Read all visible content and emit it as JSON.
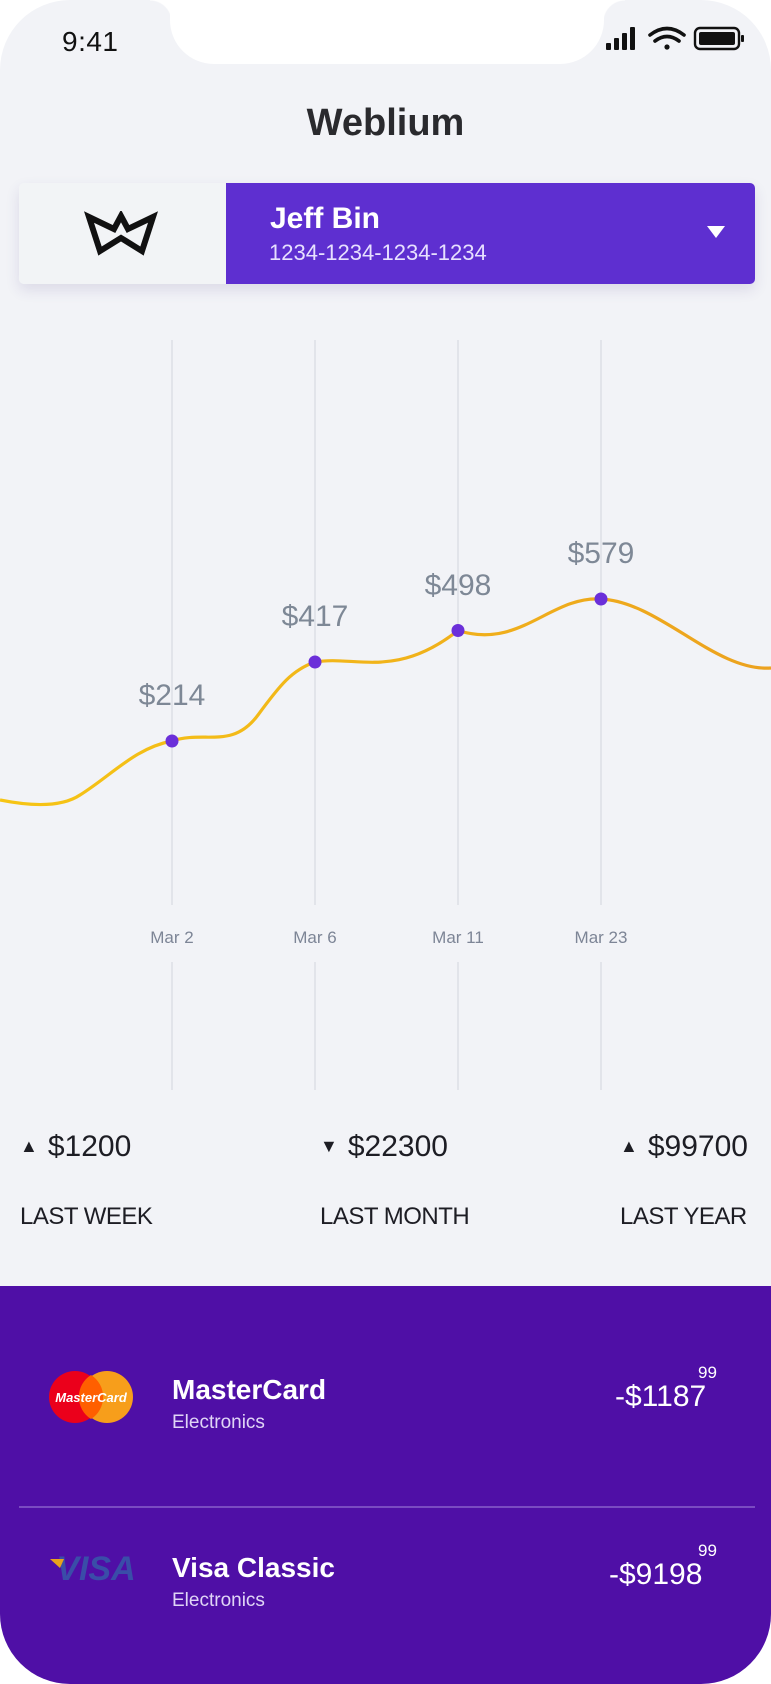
{
  "status_bar": {
    "time": "9:41"
  },
  "app": {
    "title": "Weblium"
  },
  "account": {
    "name": "Jeff Bin",
    "card_number": "1234-1234-1234-1234"
  },
  "chart_data": {
    "type": "line",
    "categories": [
      "Mar 2",
      "Mar 6",
      "Mar 11",
      "Mar 23"
    ],
    "values": [
      214,
      417,
      498,
      579
    ],
    "value_labels": [
      "$214",
      "$417",
      "$498",
      "$579"
    ],
    "title": "",
    "xlabel": "",
    "ylabel": "",
    "grid": "vertical",
    "colors": {
      "line_start": "#f5c518",
      "line_end": "#eca21f",
      "marker": "#6b2fd9",
      "grid": "#dcdfe6"
    }
  },
  "stats": [
    {
      "direction": "up",
      "arrow": "▲",
      "value": "$1200",
      "label": "LAST WEEK"
    },
    {
      "direction": "down",
      "arrow": "▼",
      "value": "$22300",
      "label": "LAST MONTH"
    },
    {
      "direction": "up",
      "arrow": "▲",
      "value": "$99700",
      "label": "LAST YEAR"
    }
  ],
  "transactions": [
    {
      "icon": "mastercard-icon",
      "logo_text": "MasterCard",
      "name": "MasterCard",
      "category": "Electronics",
      "amount": "-$1187",
      "cents": "99"
    },
    {
      "icon": "visa-icon",
      "logo_text": "VISA",
      "name": "Visa Classic",
      "category": "Electronics",
      "amount": "-$9198",
      "cents": "99"
    }
  ],
  "colors": {
    "accent": "#5e2fd0",
    "bottom_panel": "#4f0fa6",
    "background": "#f2f3f7"
  }
}
